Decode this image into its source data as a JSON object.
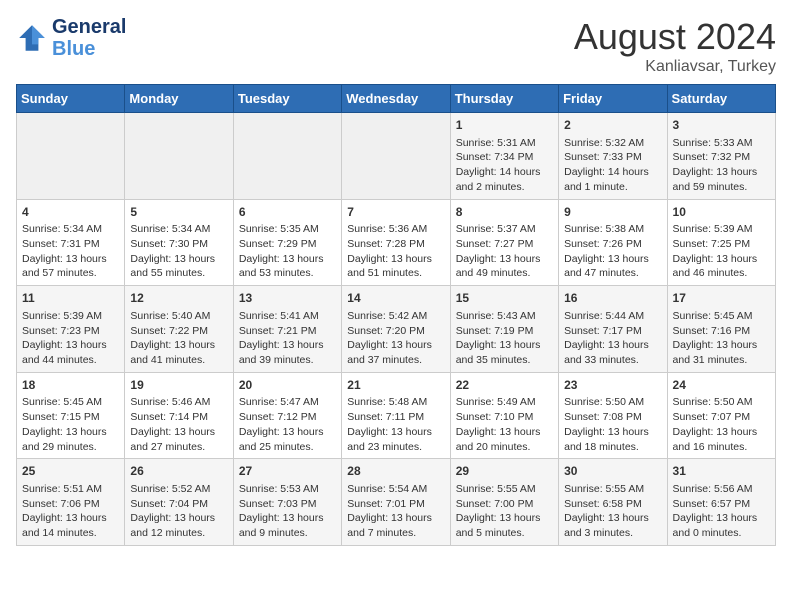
{
  "header": {
    "logo_line1": "General",
    "logo_line2": "Blue",
    "month": "August 2024",
    "location": "Kanliavsar, Turkey"
  },
  "weekdays": [
    "Sunday",
    "Monday",
    "Tuesday",
    "Wednesday",
    "Thursday",
    "Friday",
    "Saturday"
  ],
  "weeks": [
    [
      {
        "day": "",
        "content": ""
      },
      {
        "day": "",
        "content": ""
      },
      {
        "day": "",
        "content": ""
      },
      {
        "day": "",
        "content": ""
      },
      {
        "day": "1",
        "content": "Sunrise: 5:31 AM\nSunset: 7:34 PM\nDaylight: 14 hours and 2 minutes."
      },
      {
        "day": "2",
        "content": "Sunrise: 5:32 AM\nSunset: 7:33 PM\nDaylight: 14 hours and 1 minute."
      },
      {
        "day": "3",
        "content": "Sunrise: 5:33 AM\nSunset: 7:32 PM\nDaylight: 13 hours and 59 minutes."
      }
    ],
    [
      {
        "day": "4",
        "content": "Sunrise: 5:34 AM\nSunset: 7:31 PM\nDaylight: 13 hours and 57 minutes."
      },
      {
        "day": "5",
        "content": "Sunrise: 5:34 AM\nSunset: 7:30 PM\nDaylight: 13 hours and 55 minutes."
      },
      {
        "day": "6",
        "content": "Sunrise: 5:35 AM\nSunset: 7:29 PM\nDaylight: 13 hours and 53 minutes."
      },
      {
        "day": "7",
        "content": "Sunrise: 5:36 AM\nSunset: 7:28 PM\nDaylight: 13 hours and 51 minutes."
      },
      {
        "day": "8",
        "content": "Sunrise: 5:37 AM\nSunset: 7:27 PM\nDaylight: 13 hours and 49 minutes."
      },
      {
        "day": "9",
        "content": "Sunrise: 5:38 AM\nSunset: 7:26 PM\nDaylight: 13 hours and 47 minutes."
      },
      {
        "day": "10",
        "content": "Sunrise: 5:39 AM\nSunset: 7:25 PM\nDaylight: 13 hours and 46 minutes."
      }
    ],
    [
      {
        "day": "11",
        "content": "Sunrise: 5:39 AM\nSunset: 7:23 PM\nDaylight: 13 hours and 44 minutes."
      },
      {
        "day": "12",
        "content": "Sunrise: 5:40 AM\nSunset: 7:22 PM\nDaylight: 13 hours and 41 minutes."
      },
      {
        "day": "13",
        "content": "Sunrise: 5:41 AM\nSunset: 7:21 PM\nDaylight: 13 hours and 39 minutes."
      },
      {
        "day": "14",
        "content": "Sunrise: 5:42 AM\nSunset: 7:20 PM\nDaylight: 13 hours and 37 minutes."
      },
      {
        "day": "15",
        "content": "Sunrise: 5:43 AM\nSunset: 7:19 PM\nDaylight: 13 hours and 35 minutes."
      },
      {
        "day": "16",
        "content": "Sunrise: 5:44 AM\nSunset: 7:17 PM\nDaylight: 13 hours and 33 minutes."
      },
      {
        "day": "17",
        "content": "Sunrise: 5:45 AM\nSunset: 7:16 PM\nDaylight: 13 hours and 31 minutes."
      }
    ],
    [
      {
        "day": "18",
        "content": "Sunrise: 5:45 AM\nSunset: 7:15 PM\nDaylight: 13 hours and 29 minutes."
      },
      {
        "day": "19",
        "content": "Sunrise: 5:46 AM\nSunset: 7:14 PM\nDaylight: 13 hours and 27 minutes."
      },
      {
        "day": "20",
        "content": "Sunrise: 5:47 AM\nSunset: 7:12 PM\nDaylight: 13 hours and 25 minutes."
      },
      {
        "day": "21",
        "content": "Sunrise: 5:48 AM\nSunset: 7:11 PM\nDaylight: 13 hours and 23 minutes."
      },
      {
        "day": "22",
        "content": "Sunrise: 5:49 AM\nSunset: 7:10 PM\nDaylight: 13 hours and 20 minutes."
      },
      {
        "day": "23",
        "content": "Sunrise: 5:50 AM\nSunset: 7:08 PM\nDaylight: 13 hours and 18 minutes."
      },
      {
        "day": "24",
        "content": "Sunrise: 5:50 AM\nSunset: 7:07 PM\nDaylight: 13 hours and 16 minutes."
      }
    ],
    [
      {
        "day": "25",
        "content": "Sunrise: 5:51 AM\nSunset: 7:06 PM\nDaylight: 13 hours and 14 minutes."
      },
      {
        "day": "26",
        "content": "Sunrise: 5:52 AM\nSunset: 7:04 PM\nDaylight: 13 hours and 12 minutes."
      },
      {
        "day": "27",
        "content": "Sunrise: 5:53 AM\nSunset: 7:03 PM\nDaylight: 13 hours and 9 minutes."
      },
      {
        "day": "28",
        "content": "Sunrise: 5:54 AM\nSunset: 7:01 PM\nDaylight: 13 hours and 7 minutes."
      },
      {
        "day": "29",
        "content": "Sunrise: 5:55 AM\nSunset: 7:00 PM\nDaylight: 13 hours and 5 minutes."
      },
      {
        "day": "30",
        "content": "Sunrise: 5:55 AM\nSunset: 6:58 PM\nDaylight: 13 hours and 3 minutes."
      },
      {
        "day": "31",
        "content": "Sunrise: 5:56 AM\nSunset: 6:57 PM\nDaylight: 13 hours and 0 minutes."
      }
    ]
  ]
}
